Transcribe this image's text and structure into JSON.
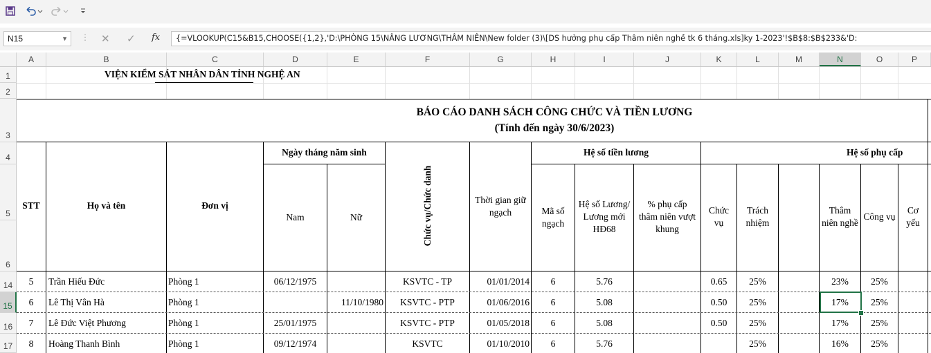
{
  "formula_bar": {
    "name_box": "N15",
    "fx_label": "fx",
    "formula": "{=VLOOKUP(C15&B15,CHOOSE({1,2},'D:\\PHÒNG 15\\NÂNG LƯƠNG\\THÂM NIÊN\\New folder (3)\\[DS hưởng phụ cấp Thâm niên nghề tk 6 tháng.xls]ky 1-2023'!$B$8:$B$233&'D:"
  },
  "quick_access": {
    "save": "save-icon",
    "undo": "undo-icon",
    "redo": "redo-icon",
    "customize": "customize-icon"
  },
  "columns": [
    "A",
    "B",
    "C",
    "D",
    "E",
    "F",
    "G",
    "H",
    "I",
    "J",
    "K",
    "L",
    "M",
    "N",
    "O",
    "P"
  ],
  "rows": [
    "1",
    "2",
    "3",
    "4",
    "5",
    "6",
    "14",
    "15",
    "16",
    "17"
  ],
  "sheet": {
    "org_title": "VIỆN KIỂM SÁT NHÂN DÂN TỈNH NGHỆ AN",
    "report_title": "BÁO CÁO DANH SÁCH CÔNG CHỨC VÀ TIỀN LƯƠNG",
    "report_subtitle": "(Tính đến ngày 30/6/2023)",
    "headers": {
      "stt": "STT",
      "name": "Họ và tên",
      "unit": "Đơn vị",
      "dob": "Ngày tháng năm sinh",
      "male": "Nam",
      "female": "Nữ",
      "position": "Chức vụ/Chức danh",
      "rank_time_1": "Thời gian giữ",
      "rank_time_2": "ngạch",
      "salary_coef": "Hệ số tiền lương",
      "rank_code_1": "Mã số",
      "rank_code_2": "ngạch",
      "salary_new_1": "Hệ số Lương/",
      "salary_new_2": "Lương mới",
      "salary_new_3": "HĐ68",
      "pct_1": "% phụ cấp",
      "pct_2": "thâm niên vượt",
      "pct_3": "khung",
      "allowance": "Hệ số phụ cấp",
      "chucvu_1": "Chức",
      "chucvu_2": "vụ",
      "trachnhiem_1": "Trách",
      "trachnhiem_2": "nhiệm",
      "thamnien_1": "Thâm",
      "thamnien_2": "niên nghề",
      "congvu": "Công vụ",
      "coyeu_1": "Cơ",
      "coyeu_2": "yếu"
    },
    "data_rows": [
      {
        "stt": "5",
        "name": "Trần Hiếu Đức",
        "unit": "Phòng 1",
        "male": "06/12/1975",
        "female": "",
        "position": "KSVTC - TP",
        "rank_time": "01/01/2014",
        "rank_code": "6",
        "salary": "5.76",
        "chucvu": "0.65",
        "trachnhiem": "25%",
        "thamnien": "23%",
        "congvu": "25%"
      },
      {
        "stt": "6",
        "name": "Lê Thị Vân Hà",
        "unit": "Phòng 1",
        "male": "",
        "female": "11/10/1980",
        "position": "KSVTC - PTP",
        "rank_time": "01/06/2016",
        "rank_code": "6",
        "salary": "5.08",
        "chucvu": "0.50",
        "trachnhiem": "25%",
        "thamnien": "17%",
        "congvu": "25%"
      },
      {
        "stt": "7",
        "name": "Lê Đức Việt Phương",
        "unit": "Phòng 1",
        "male": "25/01/1975",
        "female": "",
        "position": "KSVTC - PTP",
        "rank_time": "01/05/2018",
        "rank_code": "6",
        "salary": "5.08",
        "chucvu": "0.50",
        "trachnhiem": "25%",
        "thamnien": "17%",
        "congvu": "25%"
      },
      {
        "stt": "8",
        "name": "Hoàng Thanh Bình",
        "unit": "Phòng 1",
        "male": "09/12/1974",
        "female": "",
        "position": "KSVTC",
        "rank_time": "01/10/2010",
        "rank_code": "6",
        "salary": "5.76",
        "chucvu": "",
        "trachnhiem": "25%",
        "thamnien": "16%",
        "congvu": "25%"
      }
    ]
  }
}
